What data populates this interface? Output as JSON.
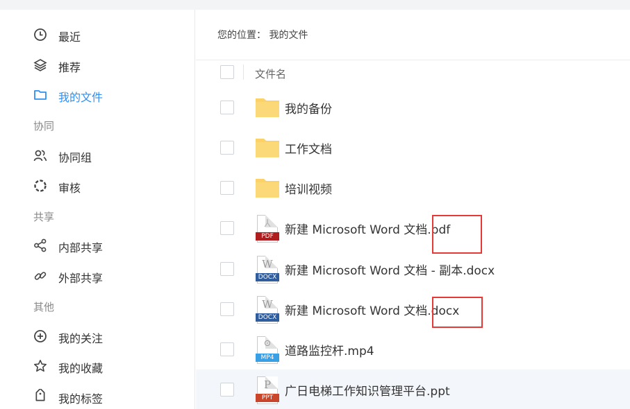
{
  "sidebar": {
    "items": [
      {
        "label": "最近",
        "icon": "clock-icon"
      },
      {
        "label": "推荐",
        "icon": "layers-icon"
      },
      {
        "label": "我的文件",
        "icon": "folder-icon",
        "active": true
      },
      {
        "label": "协同组",
        "icon": "users-icon"
      },
      {
        "label": "审核",
        "icon": "dotted-circle-icon"
      },
      {
        "label": "内部共享",
        "icon": "share-icon"
      },
      {
        "label": "外部共享",
        "icon": "link-icon"
      },
      {
        "label": "我的关注",
        "icon": "plus-circle-icon"
      },
      {
        "label": "我的收藏",
        "icon": "star-icon"
      },
      {
        "label": "我的标签",
        "icon": "tag-icon"
      }
    ],
    "sections": {
      "collab": "协同",
      "share": "共享",
      "other": "其他"
    }
  },
  "main": {
    "breadcrumb": "您的位置： 我的文件",
    "column_header": "文件名",
    "files": [
      {
        "name": "我的备份",
        "type": "folder"
      },
      {
        "name": "工作文档",
        "type": "folder"
      },
      {
        "name": "培训视频",
        "type": "folder"
      },
      {
        "name": "新建 Microsoft Word 文档.pdf",
        "type": "pdf",
        "tag": "PDF"
      },
      {
        "name": "新建 Microsoft Word 文档 - 副本.docx",
        "type": "docx",
        "tag": "DOCX"
      },
      {
        "name": "新建 Microsoft Word 文档.docx",
        "type": "docx",
        "tag": "DOCX"
      },
      {
        "name": "道路监控杆.mp4",
        "type": "mp4",
        "tag": "MP4"
      },
      {
        "name": "广日电梯工作知识管理平台.ppt",
        "type": "ppt",
        "tag": "PPT"
      }
    ]
  },
  "colors": {
    "accent": "#2f8ff1",
    "folder": "#fbd26a",
    "pdf_tag": "#b01f1f",
    "docx_tag": "#2f5d9e",
    "mp4_tag": "#3aa0e6",
    "ppt_tag": "#c9462b",
    "highlight_box": "#e53935"
  }
}
